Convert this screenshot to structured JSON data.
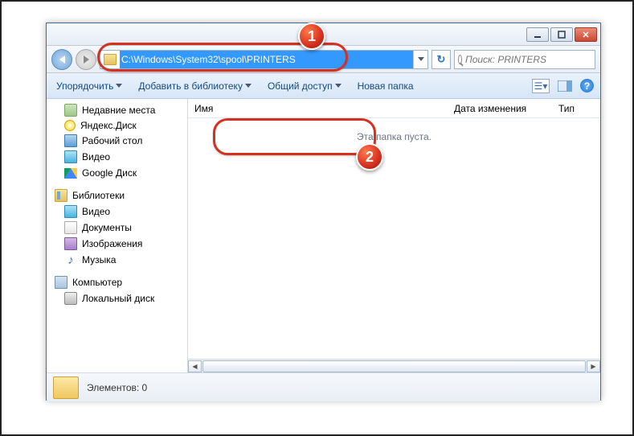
{
  "address_bar": {
    "path": "C:\\Windows\\System32\\spool\\PRINTERS"
  },
  "search": {
    "placeholder": "Поиск: PRINTERS"
  },
  "toolbar": {
    "organize": "Упорядочить",
    "add_to_library": "Добавить в библиотеку",
    "share": "Общий доступ",
    "new_folder": "Новая папка"
  },
  "sidebar": {
    "items": [
      {
        "label": "Недавние места"
      },
      {
        "label": "Яндекс.Диск"
      },
      {
        "label": "Рабочий стол"
      },
      {
        "label": "Видео"
      },
      {
        "label": "Google Диск"
      }
    ],
    "libraries_group": "Библиотеки",
    "libraries": [
      {
        "label": "Видео"
      },
      {
        "label": "Документы"
      },
      {
        "label": "Изображения"
      },
      {
        "label": "Музыка"
      }
    ],
    "computer_group": "Компьютер",
    "local_disk": "Локальный диск"
  },
  "columns": {
    "name": "Имя",
    "date": "Дата изменения",
    "type": "Тип"
  },
  "content": {
    "empty_message": "Эта папка пуста."
  },
  "status": {
    "elements": "Элементов: 0"
  },
  "callouts": {
    "one": "1",
    "two": "2"
  }
}
